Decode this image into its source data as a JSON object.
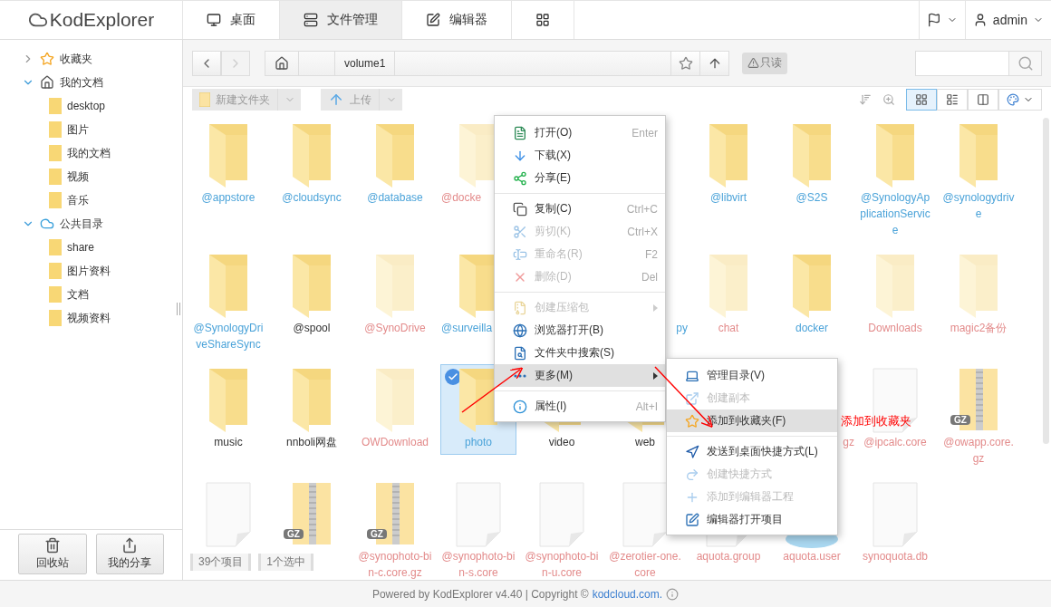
{
  "header": {
    "logo": "KodExplorer",
    "tabs": [
      {
        "label": "桌面",
        "selected": false
      },
      {
        "label": "文件管理",
        "selected": true
      },
      {
        "label": "编辑器",
        "selected": false
      },
      {
        "selected": false
      }
    ],
    "user": "admin"
  },
  "sidebar": {
    "tree": [
      {
        "label": "收藏夹",
        "expanded": false
      },
      {
        "label": "我的文档",
        "expanded": true,
        "children": [
          {
            "label": "desktop"
          },
          {
            "label": "图片"
          },
          {
            "label": "我的文档"
          },
          {
            "label": "视频"
          },
          {
            "label": "音乐"
          }
        ]
      },
      {
        "label": "公共目录",
        "expanded": true,
        "children": [
          {
            "label": "share"
          },
          {
            "label": "图片资料"
          },
          {
            "label": "文档"
          },
          {
            "label": "视频资料"
          }
        ]
      }
    ],
    "buttons": [
      "回收站",
      "我的分享"
    ]
  },
  "address": {
    "breadcrumb": [
      "volume1"
    ],
    "readonly_badge": "只读"
  },
  "toolbar": {
    "new_folder": "新建文件夹",
    "upload": "上传",
    "views": [
      {
        "selected": true
      },
      {
        "selected": false
      },
      {
        "selected": false
      }
    ]
  },
  "files": [
    {
      "kind": "folder",
      "label": "@appstore",
      "color": "#4ba3d9",
      "faded": false,
      "selected": false
    },
    {
      "kind": "folder",
      "label": "@cloudsync",
      "color": "#4ba3d9",
      "faded": false,
      "selected": false
    },
    {
      "kind": "folder",
      "label": "@database",
      "color": "#4ba3d9",
      "faded": false,
      "selected": false
    },
    {
      "kind": "folder",
      "label": "@docke",
      "clipped_end": true,
      "color": "#e38b8b",
      "faded": true,
      "selected": false
    },
    {
      "kind": "folder"
    },
    {
      "kind": "folder"
    },
    {
      "kind": "folder",
      "label": "@libvirt",
      "color": "#4ba3d9",
      "faded": false,
      "selected": false
    },
    {
      "kind": "folder",
      "label": "@S2S",
      "color": "#4ba3d9",
      "faded": false,
      "selected": false
    },
    {
      "kind": "folder",
      "label": "@SynologyApplicationService",
      "color": "#4ba3d9",
      "faded": false,
      "selected": false
    },
    {
      "kind": "folder",
      "label": "@synologydrive",
      "color": "#4ba3d9",
      "faded": false,
      "selected": false
    },
    {
      "kind": "folder",
      "label": "@SynologyDriveShareSync",
      "color": "#4ba3d9",
      "faded": false,
      "selected": false
    },
    {
      "kind": "folder",
      "label": "@spool",
      "color": "#333333",
      "faded": false,
      "selected": false
    },
    {
      "kind": "folder",
      "label": "@SynoDrive",
      "color": "#e38b8b",
      "faded": true,
      "selected": false
    },
    {
      "kind": "folder",
      "label": "@surveilla",
      "clipped_end": true,
      "color": "#4ba3d9",
      "faded": false,
      "selected": false
    },
    {
      "kind": "folder"
    },
    {
      "kind": "folder",
      "label": "py",
      "clipped_start": true,
      "color": "#4ba3d9"
    },
    {
      "kind": "folder",
      "label": "chat",
      "color": "#e38b8b",
      "faded": true,
      "selected": false
    },
    {
      "kind": "folder",
      "label": "docker",
      "color": "#4ba3d9",
      "faded": false,
      "selected": false
    },
    {
      "kind": "folder",
      "label": "Downloads",
      "color": "#e38b8b",
      "faded": true,
      "selected": false
    },
    {
      "kind": "folder",
      "label": "magic2备份",
      "color": "#e38b8b",
      "faded": true,
      "selected": false
    },
    {
      "kind": "folder",
      "label": "music",
      "color": "#333333",
      "faded": false,
      "selected": false
    },
    {
      "kind": "folder",
      "label": "nnboli网盘",
      "color": "#333333",
      "faded": false,
      "selected": false
    },
    {
      "kind": "folder",
      "label": "OWDownload",
      "color": "#e38b8b",
      "faded": true,
      "selected": false
    },
    {
      "kind": "folder",
      "label": "photo",
      "color": "#4ba3d9",
      "faded": false,
      "selected": true
    },
    {
      "kind": "folder",
      "label": "video",
      "color": "#333333",
      "faded": false,
      "selected": false
    },
    {
      "kind": "folder",
      "label": "web",
      "color": "#333333",
      "faded": false,
      "selected": false
    },
    {
      "kind": "file"
    },
    {
      "kind": "file",
      "label": "gz",
      "clipped_start": true,
      "color": "#e38b8b"
    },
    {
      "kind": "file",
      "label": "@ipcalc.core",
      "color": "#e38b8b",
      "faded": false,
      "selected": false
    },
    {
      "kind": "archive",
      "label": "@owapp.core.gz",
      "badge": "GZ",
      "color": "#e38b8b",
      "faded": false,
      "selected": false
    },
    {
      "kind": "file",
      "faded": false,
      "selected": false
    },
    {
      "kind": "archive",
      "badge": "GZ",
      "faded": false,
      "selected": false
    },
    {
      "kind": "archive",
      "label": "@synophoto-bin-c.core.gz",
      "badge": "GZ",
      "color": "#e38b8b",
      "faded": false,
      "selected": false
    },
    {
      "kind": "file",
      "label": "@synophoto-bin-s.core",
      "color": "#e38b8b",
      "faded": false,
      "selected": false
    },
    {
      "kind": "file",
      "label": "@synophoto-bin-u.core",
      "color": "#e38b8b",
      "faded": false,
      "selected": false
    },
    {
      "kind": "file",
      "label": "@zerotier-one.core",
      "color": "#e38b8b",
      "faded": false,
      "selected": false
    },
    {
      "kind": "file",
      "label": "aquota.group",
      "color": "#e38b8b",
      "faded": false,
      "selected": false
    },
    {
      "kind": "disk",
      "label": "aquota.user",
      "color": "#e38b8b",
      "faded": false,
      "selected": false
    },
    {
      "kind": "file",
      "label": "synoquota.db",
      "color": "#e38b8b",
      "faded": false,
      "selected": false
    }
  ],
  "status": {
    "item_count": "39个项目",
    "selection": "1个选中"
  },
  "context_menu": [
    {
      "kind": "item",
      "label": "打开(O)",
      "shortcut": "Enter",
      "disabled": false,
      "highlighted": false,
      "submenu": false
    },
    {
      "kind": "item",
      "label": "下载(X)",
      "disabled": false,
      "highlighted": false,
      "submenu": false
    },
    {
      "kind": "item",
      "label": "分享(E)",
      "disabled": false,
      "highlighted": false,
      "submenu": false
    },
    {
      "kind": "separator"
    },
    {
      "kind": "item",
      "label": "复制(C)",
      "shortcut": "Ctrl+C",
      "disabled": false,
      "highlighted": false,
      "submenu": false
    },
    {
      "kind": "item",
      "label": "剪切(K)",
      "shortcut": "Ctrl+X",
      "disabled": true,
      "highlighted": false,
      "submenu": false
    },
    {
      "kind": "item",
      "label": "重命名(R)",
      "shortcut": "F2",
      "disabled": true,
      "highlighted": false,
      "submenu": false
    },
    {
      "kind": "item",
      "label": "删除(D)",
      "shortcut": "Del",
      "disabled": true,
      "highlighted": false,
      "submenu": false
    },
    {
      "kind": "separator"
    },
    {
      "kind": "item",
      "label": "创建压缩包",
      "disabled": true,
      "highlighted": false,
      "submenu": true
    },
    {
      "kind": "item",
      "label": "浏览器打开(B)",
      "disabled": false,
      "highlighted": false,
      "submenu": false
    },
    {
      "kind": "item",
      "label": "文件夹中搜索(S)",
      "disabled": false,
      "highlighted": false,
      "submenu": false
    },
    {
      "kind": "item",
      "label": "更多(M)",
      "disabled": false,
      "highlighted": true,
      "submenu": true
    },
    {
      "kind": "separator"
    },
    {
      "kind": "item",
      "label": "属性(I)",
      "shortcut": "Alt+I",
      "disabled": false,
      "highlighted": false,
      "submenu": false
    }
  ],
  "submenu": [
    {
      "kind": "item",
      "label": "管理目录(V)",
      "disabled": false,
      "highlighted": false
    },
    {
      "kind": "item",
      "label": "创建副本",
      "disabled": true,
      "highlighted": false
    },
    {
      "kind": "item",
      "label": "添加到收藏夹(F)",
      "disabled": false,
      "highlighted": true
    },
    {
      "kind": "separator"
    },
    {
      "kind": "item",
      "label": "发送到桌面快捷方式(L)",
      "disabled": false,
      "highlighted": false
    },
    {
      "kind": "item",
      "label": "创建快捷方式",
      "disabled": true,
      "highlighted": false
    },
    {
      "kind": "item",
      "label": "添加到编辑器工程",
      "disabled": true,
      "highlighted": false
    },
    {
      "kind": "item",
      "label": "编辑器打开项目",
      "disabled": false,
      "highlighted": false
    }
  ],
  "annotation": {
    "text": "添加到收藏夹"
  },
  "footer": {
    "text": "Powered by KodExplorer v4.40 | Copyright © ",
    "link": "kodcloud.com."
  }
}
